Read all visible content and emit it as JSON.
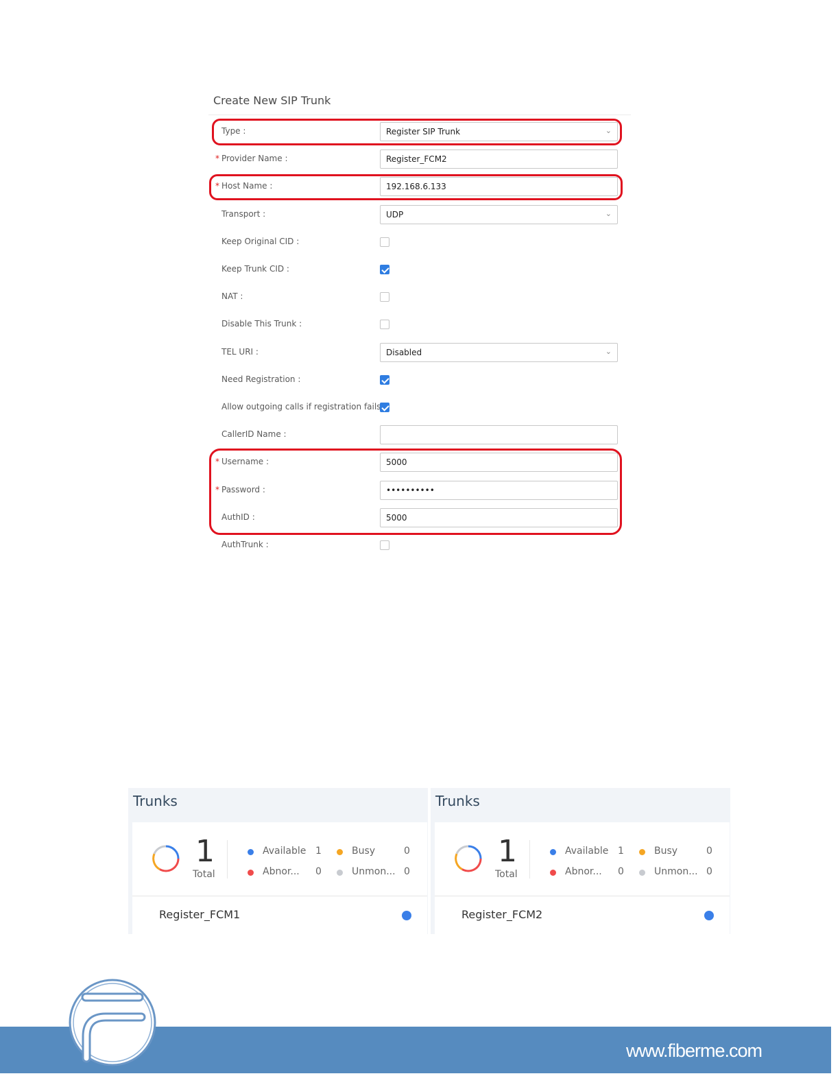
{
  "form": {
    "title": "Create New SIP Trunk",
    "rows": [
      {
        "label": "Type :",
        "required": false,
        "kind": "select",
        "value": "Register SIP Trunk"
      },
      {
        "label": "Provider Name :",
        "required": true,
        "kind": "input",
        "value": "Register_FCM2"
      },
      {
        "label": "Host Name :",
        "required": true,
        "kind": "input",
        "value": "192.168.6.133"
      },
      {
        "label": "Transport :",
        "required": false,
        "kind": "select",
        "value": "UDP"
      },
      {
        "label": "Keep Original CID :",
        "required": false,
        "kind": "checkbox",
        "checked": false
      },
      {
        "label": "Keep Trunk CID :",
        "required": false,
        "kind": "checkbox",
        "checked": true
      },
      {
        "label": "NAT :",
        "required": false,
        "kind": "checkbox",
        "checked": false
      },
      {
        "label": "Disable This Trunk :",
        "required": false,
        "kind": "checkbox",
        "checked": false
      },
      {
        "label": "TEL URI :",
        "required": false,
        "kind": "select",
        "value": "Disabled"
      },
      {
        "label": "Need Registration :",
        "required": false,
        "kind": "checkbox",
        "checked": true
      },
      {
        "label": "Allow outgoing calls if registration fails :",
        "required": false,
        "kind": "checkbox",
        "checked": true
      },
      {
        "label": "CallerID Name :",
        "required": false,
        "kind": "input",
        "value": ""
      },
      {
        "label": "Username :",
        "required": true,
        "kind": "input",
        "value": "5000"
      },
      {
        "label": "Password :",
        "required": true,
        "kind": "input",
        "value": "••••••••••"
      },
      {
        "label": "AuthID :",
        "required": false,
        "kind": "input",
        "value": "5000"
      },
      {
        "label": "AuthTrunk :",
        "required": false,
        "kind": "checkbox",
        "checked": false
      }
    ]
  },
  "panels": [
    {
      "title": "Trunks",
      "total": "1",
      "total_label": "Total",
      "stats": [
        {
          "name": "Available",
          "value": "1",
          "color": "#3a7fe8"
        },
        {
          "name": "Busy",
          "value": "0",
          "color": "#f5a623"
        },
        {
          "name": "Abnor...",
          "value": "0",
          "color": "#f04b4b"
        },
        {
          "name": "Unmon...",
          "value": "0",
          "color": "#c8cbd0"
        }
      ],
      "trunk": "Register_FCM1",
      "status_color": "#3a7fe8"
    },
    {
      "title": "Trunks",
      "total": "1",
      "total_label": "Total",
      "stats": [
        {
          "name": "Available",
          "value": "1",
          "color": "#3a7fe8"
        },
        {
          "name": "Busy",
          "value": "0",
          "color": "#f5a623"
        },
        {
          "name": "Abnor...",
          "value": "0",
          "color": "#f04b4b"
        },
        {
          "name": "Unmon...",
          "value": "0",
          "color": "#c8cbd0"
        }
      ],
      "trunk": "Register_FCM2",
      "status_color": "#3a7fe8"
    }
  ],
  "footer": {
    "url": "www.fiberme.com",
    "band_color": "#568bbf"
  },
  "icons": {
    "select_chevron": "chevron-down-icon",
    "logo": "fiberme-logo-icon",
    "donut": "trunk-status-donut-icon"
  },
  "colors": {
    "highlight": "#e0121f",
    "checkbox_on": "#2f7de1",
    "required_star": "#e02020"
  }
}
